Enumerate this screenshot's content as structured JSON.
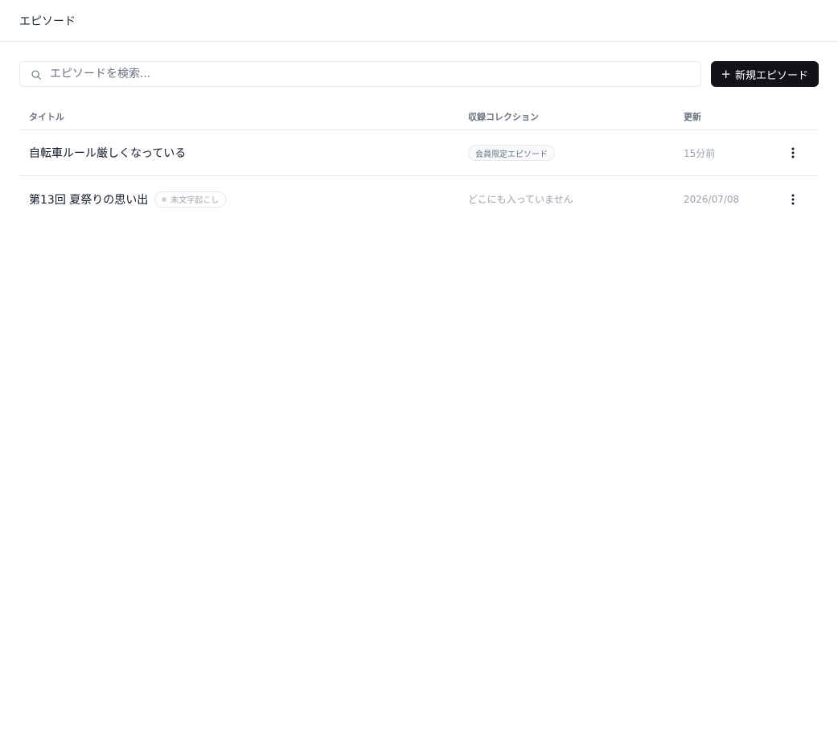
{
  "header": {
    "title": "エピソード"
  },
  "toolbar": {
    "search_placeholder": "エピソードを検索...",
    "new_button_label": "新規エピソード"
  },
  "table": {
    "columns": [
      "タイトル",
      "収録コレクション",
      "更新"
    ],
    "rows": [
      {
        "title": "自転車ルール厳しくなっている",
        "collection": "会員限定エピソード",
        "updated": "15分前"
      },
      {
        "title": "第13回 夏祭りの思い出",
        "status_badge": "未文字起こし",
        "collection_none": "どこにも入っていません",
        "updated": "2026/07/08"
      }
    ]
  },
  "icons": {
    "search": "search-icon",
    "plus": "plus-icon",
    "more": "more-vertical-icon"
  },
  "colors": {
    "primary_button": "#111318",
    "border": "#e5e7eb",
    "muted_text": "#9ca3af"
  }
}
